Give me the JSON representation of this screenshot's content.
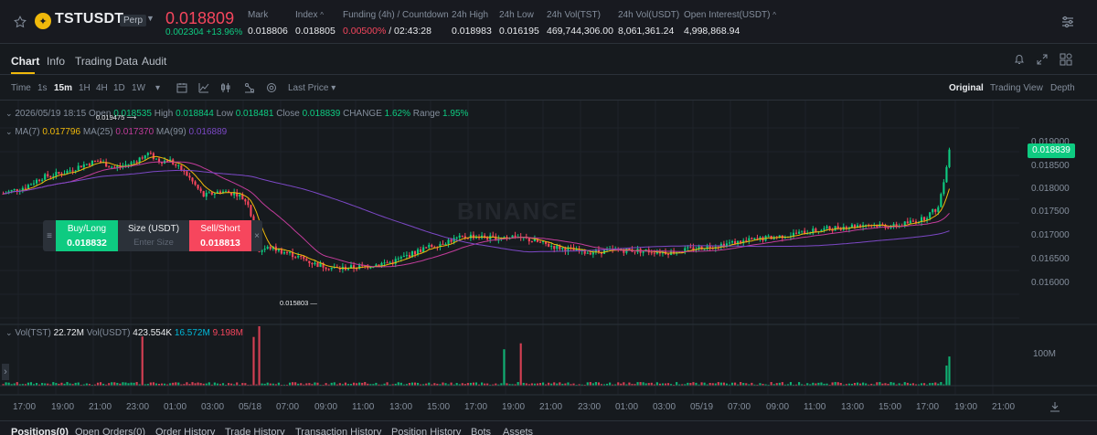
{
  "header": {
    "symbol": "TSTUSDT",
    "contract_type": "Perp",
    "last_price": "0.018809",
    "change": "0.002304 +13.96%",
    "stats": [
      {
        "label": "Mark",
        "value": "0.018806"
      },
      {
        "label": "Index",
        "value": "0.018805"
      },
      {
        "label": "Funding (4h) / Countdown",
        "value_a": "0.00500%",
        "value_b": " / 02:43:28"
      },
      {
        "label": "24h High",
        "value": "0.018983"
      },
      {
        "label": "24h Low",
        "value": "0.016195"
      },
      {
        "label": "24h Vol(TST)",
        "value": "469,744,306.00"
      },
      {
        "label": "24h Vol(USDT)",
        "value": "8,061,361.24"
      },
      {
        "label": "Open Interest(USDT)",
        "value": "4,998,868.94"
      }
    ]
  },
  "tabs": [
    "Chart",
    "Info",
    "Trading Data",
    "Audit"
  ],
  "toolbar": {
    "intervals": [
      "Time",
      "1s",
      "15m",
      "1H",
      "4H",
      "1D",
      "1W"
    ],
    "active_interval": "15m",
    "price_source": "Last Price",
    "views": [
      "Original",
      "Trading View",
      "Depth"
    ],
    "active_view": "Original"
  },
  "ohlc": {
    "date": "2026/05/19 18:15",
    "open_label": "Open",
    "open": "0.018535",
    "high_label": "High",
    "high": "0.018844",
    "low_label": "Low",
    "low": "0.018481",
    "close_label": "Close",
    "close": "0.018839",
    "change_label": "CHANGE",
    "change": "1.62%",
    "range_label": "Range",
    "range": "1.95%"
  },
  "ma": {
    "ma7_label": "MA(7)",
    "ma7": "0.017796",
    "ma25_label": "MA(25)",
    "ma25": "0.017370",
    "ma99_label": "MA(99)",
    "ma99": "0.016889"
  },
  "volume": {
    "vol_label": "Vol(TST)",
    "vol": "22.72M",
    "vol_usdt_label": "Vol(USDT)",
    "vol_usdt": "423.554K",
    "ma1": "16.572M",
    "ma2": "9.198M",
    "axis_label": "100M"
  },
  "order_panel": {
    "buy_label": "Buy/Long",
    "buy_price": "0.018832",
    "size_label": "Size (USDT)",
    "size_placeholder": "Enter Size",
    "sell_label": "Sell/Short",
    "sell_price": "0.018813"
  },
  "price_axis": [
    "0.019000",
    "0.018500",
    "0.018000",
    "0.017500",
    "0.017000",
    "0.016500",
    "0.016000"
  ],
  "current_price_tag": "0.018839",
  "annotations": {
    "high": "0.019475",
    "low": "0.015803"
  },
  "watermark": "BINANCE",
  "time_axis": [
    "17:00",
    "19:00",
    "21:00",
    "23:00",
    "01:00",
    "03:00",
    "05/18",
    "07:00",
    "09:00",
    "11:00",
    "13:00",
    "15:00",
    "17:00",
    "19:00",
    "21:00",
    "23:00",
    "01:00",
    "03:00",
    "05/19",
    "07:00",
    "09:00",
    "11:00",
    "13:00",
    "15:00",
    "17:00",
    "19:00",
    "21:00"
  ],
  "bottom_tabs": [
    "Positions(0)",
    "Open Orders(0)",
    "Order History",
    "Trade History",
    "Transaction History",
    "Position History",
    "Bots",
    "Assets"
  ],
  "colors": {
    "up": "#0ecb81",
    "down": "#f6465d",
    "ma7": "#f0b90b",
    "ma25": "#c23c9b",
    "ma99": "#7c48c6",
    "accent": "#f0b90b"
  },
  "chart_data": {
    "type": "candlestick",
    "interval": "15m",
    "ylim": [
      0.0156,
      0.0193
    ],
    "close_anchors": [
      [
        0,
        0.0179
      ],
      [
        8,
        0.01805
      ],
      [
        14,
        0.01825
      ],
      [
        22,
        0.01835
      ],
      [
        28,
        0.0185
      ],
      [
        34,
        0.0186
      ],
      [
        40,
        0.01845
      ],
      [
        46,
        0.01855
      ],
      [
        52,
        0.01875
      ],
      [
        56,
        0.0186
      ],
      [
        60,
        0.0186
      ],
      [
        66,
        0.0183
      ],
      [
        72,
        0.01785
      ],
      [
        78,
        0.01795
      ],
      [
        84,
        0.0179
      ],
      [
        88,
        0.0177
      ],
      [
        92,
        0.0167
      ],
      [
        96,
        0.01675
      ],
      [
        104,
        0.0166
      ],
      [
        112,
        0.0164
      ],
      [
        120,
        0.0163
      ],
      [
        130,
        0.01635
      ],
      [
        140,
        0.01645
      ],
      [
        150,
        0.0167
      ],
      [
        160,
        0.0169
      ],
      [
        168,
        0.017
      ],
      [
        176,
        0.01695
      ],
      [
        184,
        0.017
      ],
      [
        196,
        0.0168
      ],
      [
        208,
        0.01665
      ],
      [
        224,
        0.0167
      ],
      [
        240,
        0.01665
      ],
      [
        256,
        0.0168
      ],
      [
        268,
        0.0169
      ],
      [
        280,
        0.017
      ],
      [
        296,
        0.01715
      ],
      [
        310,
        0.01725
      ],
      [
        320,
        0.0172
      ],
      [
        330,
        0.01735
      ],
      [
        336,
        0.0176
      ],
      [
        340,
        0.0188
      ]
    ]
  }
}
